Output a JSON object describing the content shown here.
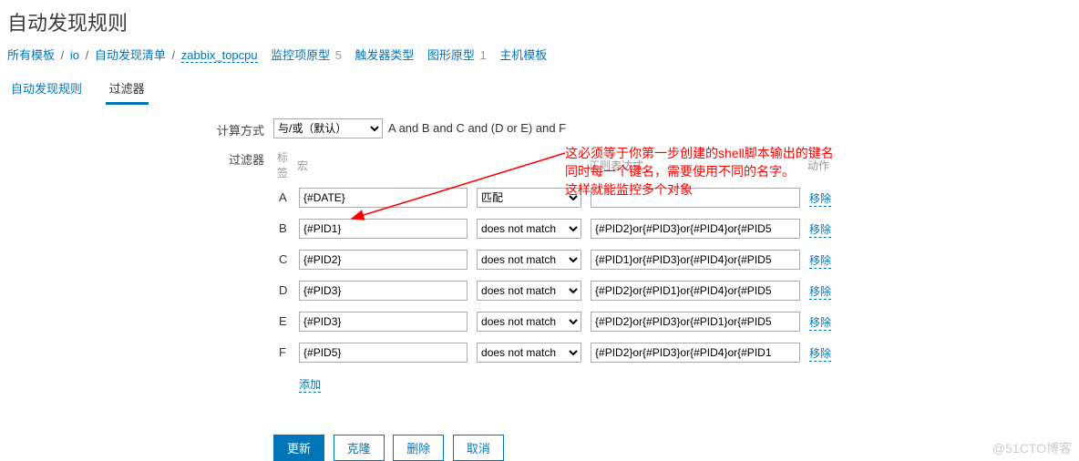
{
  "page_title": "自动发现规则",
  "breadcrumb": {
    "all_templates": "所有模板",
    "io": "io",
    "discovery_list": "自动发现清单",
    "rule_name": "zabbix_topcpu",
    "item_proto": "监控项原型",
    "item_proto_count": "5",
    "trigger_proto": "触发器类型",
    "graph_proto": "图形原型",
    "graph_proto_count": "1",
    "host_proto": "主机模板"
  },
  "tabs": {
    "rule": "自动发现规则",
    "filters": "过滤器"
  },
  "form": {
    "calc_label": "计算方式",
    "calc_option": "与/或（默认）",
    "formula": "A and B and C and (D or E) and F",
    "filter_label": "过滤器",
    "col_label": "标签",
    "col_macro": "宏",
    "col_regex": "正则表达式",
    "col_action": "动作"
  },
  "rows": [
    {
      "letter": "A",
      "macro": "{#DATE}",
      "op": "匹配",
      "expr": "",
      "remove": "移除"
    },
    {
      "letter": "B",
      "macro": "{#PID1}",
      "op": "does not match",
      "expr": "{#PID2}or{#PID3}or{#PID4}or{#PID5",
      "remove": "移除"
    },
    {
      "letter": "C",
      "macro": "{#PID2}",
      "op": "does not match",
      "expr": "{#PID1}or{#PID3}or{#PID4}or{#PID5",
      "remove": "移除"
    },
    {
      "letter": "D",
      "macro": "{#PID3}",
      "op": "does not match",
      "expr": "{#PID2}or{#PID1}or{#PID4}or{#PID5",
      "remove": "移除"
    },
    {
      "letter": "E",
      "macro": "{#PID3}",
      "op": "does not match",
      "expr": "{#PID2}or{#PID3}or{#PID1}or{#PID5",
      "remove": "移除"
    },
    {
      "letter": "F",
      "macro": "{#PID5}",
      "op": "does not match",
      "expr": "{#PID2}or{#PID3}or{#PID4}or{#PID1",
      "remove": "移除"
    }
  ],
  "add_label": "添加",
  "buttons": {
    "update": "更新",
    "clone": "克隆",
    "delete": "删除",
    "cancel": "取消"
  },
  "annotation": {
    "line1": "这必须等于你第一步创建的shell脚本输出的键名",
    "line2": "同时每一个键名，需要使用不同的名字。",
    "line3": "这样就能监控多个对象"
  },
  "watermark": "@51CTO博客"
}
